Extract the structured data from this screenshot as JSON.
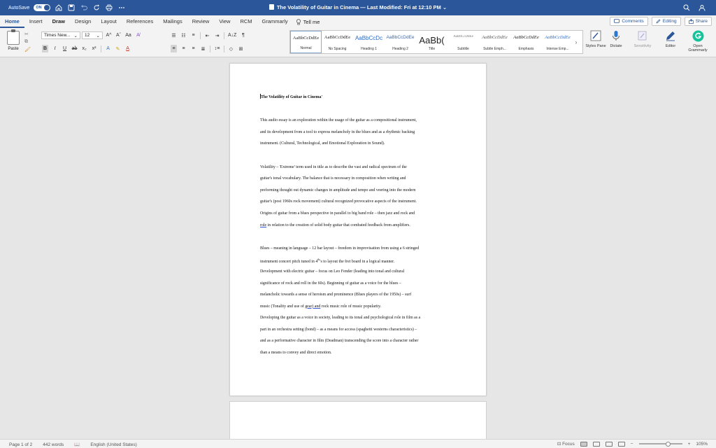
{
  "titlebar": {
    "autosave_label": "AutoSave",
    "autosave_state": "ON",
    "title": "The Volatility of Guitar in Cinema — Last Modified: Fri at 12:10 PM",
    "chevron": "⌄"
  },
  "tabs": [
    "Home",
    "Insert",
    "Draw",
    "Design",
    "Layout",
    "References",
    "Mailings",
    "Review",
    "View",
    "RCM",
    "Grammarly"
  ],
  "tell_me": "Tell me",
  "tab_actions": {
    "comments": "Comments",
    "editing": "Editing",
    "share": "Share"
  },
  "ribbon": {
    "paste_label": "Paste",
    "font_name": "Times New...",
    "font_size": "12",
    "bold": "B",
    "italic": "I",
    "underline": "U",
    "strike": "ab",
    "subscript": "x₂",
    "superscript": "x²",
    "grow": "A^",
    "shrink": "Aˇ",
    "case": "Aa",
    "pilcrow": "¶",
    "sort": "A↓Z"
  },
  "styles": [
    {
      "preview": "AaBbCcDdEe",
      "name": "Normal"
    },
    {
      "preview": "AaBbCcDdEe",
      "name": "No Spacing"
    },
    {
      "preview": "AaBbCcDc",
      "name": "Heading 1"
    },
    {
      "preview": "AaBbCcDdEe",
      "name": "Heading 2"
    },
    {
      "preview": "AaBb(",
      "name": "Title"
    },
    {
      "preview": "AaBbCcDdEe",
      "name": "Subtitle"
    },
    {
      "preview": "AaBbCcDdEe",
      "name": "Subtle Emph..."
    },
    {
      "preview": "AaBbCcDdEe",
      "name": "Emphasis"
    },
    {
      "preview": "AaBbCcDdEe",
      "name": "Intense Emp..."
    }
  ],
  "big_buttons": {
    "styles_pane": "Styles Pane",
    "dictate": "Dictate",
    "sensitivity": "Sensitivity",
    "editor": "Editor",
    "open_grammarly": "Open Grammarly"
  },
  "document": {
    "title": "The Volatility of Guitar in Cinema'",
    "para1": [
      "This audio essay is an exploration within the usage of the guitar as a compositional instrument,",
      "and its development from a tool to express melancholy in the blues and as a rhythmic backing",
      "instrument. (Cultural, Technological, and Emotional Exploration in Sound)."
    ],
    "para2": [
      "Volatility – 'Extreme' term used in title as to describe the vast and radical spectrum of the",
      "guitar's tonal vocabulary. The balance that is necessary in composition when writing and",
      "preforming thought out dynamic changes in amplitude and tempo and veering into the modern",
      "guitar's (post 1960s rock movement) cultural recognized provocative aspects of the instrument.",
      "Origins of guitar from a blues perspective in parallel to big band role – then jazz and rock and"
    ],
    "para2_last_ul": "role",
    "para2_last_rest": " in relation to the creation of solid body guitar that combated feedback from amplifiers.",
    "para3_l1": "Blues – meaning in language – 12 bar layout – freedom in improvisation from using a 6 stringed",
    "para3_l2_pre": "instrument concert pitch tuned in 4",
    "para3_l2_sup": "th",
    "para3_l2_post": "'s to layout the fret board in a logical manner.",
    "para3_rest": [
      "Development with electric guitar – focus on Leo Fender (leading into tonal and cultural",
      "significance of rock and roll in the 60s). Beginning of guitar as a voice for the blues –",
      "melancholic towards a sense of heroism and prominence (Blues players of the 1950s) – surf"
    ],
    "para3_l6_pre": "music (Tonality and use of ",
    "para3_l6_ul": "gear)  and",
    "para3_l6_post": " rock music role of music popularity.",
    "para4": [
      "Developing the guitar as a voice in society, leading to its tonal and psychological role in film as a",
      "part in an orchestra setting (bond) – as a means for access (spaghetti westerns characteristics) –",
      "and as a performative character in film (Deadman) transcending the score into a character rather",
      "than a means to convey and direct emotion."
    ]
  },
  "statusbar": {
    "page": "Page 1 of 2",
    "words": "442 words",
    "language": "English (United States)",
    "focus": "Focus",
    "zoom_minus": "−",
    "zoom_plus": "+",
    "zoom": "105%"
  },
  "colors": {
    "accent": "#2b579a",
    "grammarly": "#15c39a",
    "page_bg": "#e6e6e6"
  }
}
